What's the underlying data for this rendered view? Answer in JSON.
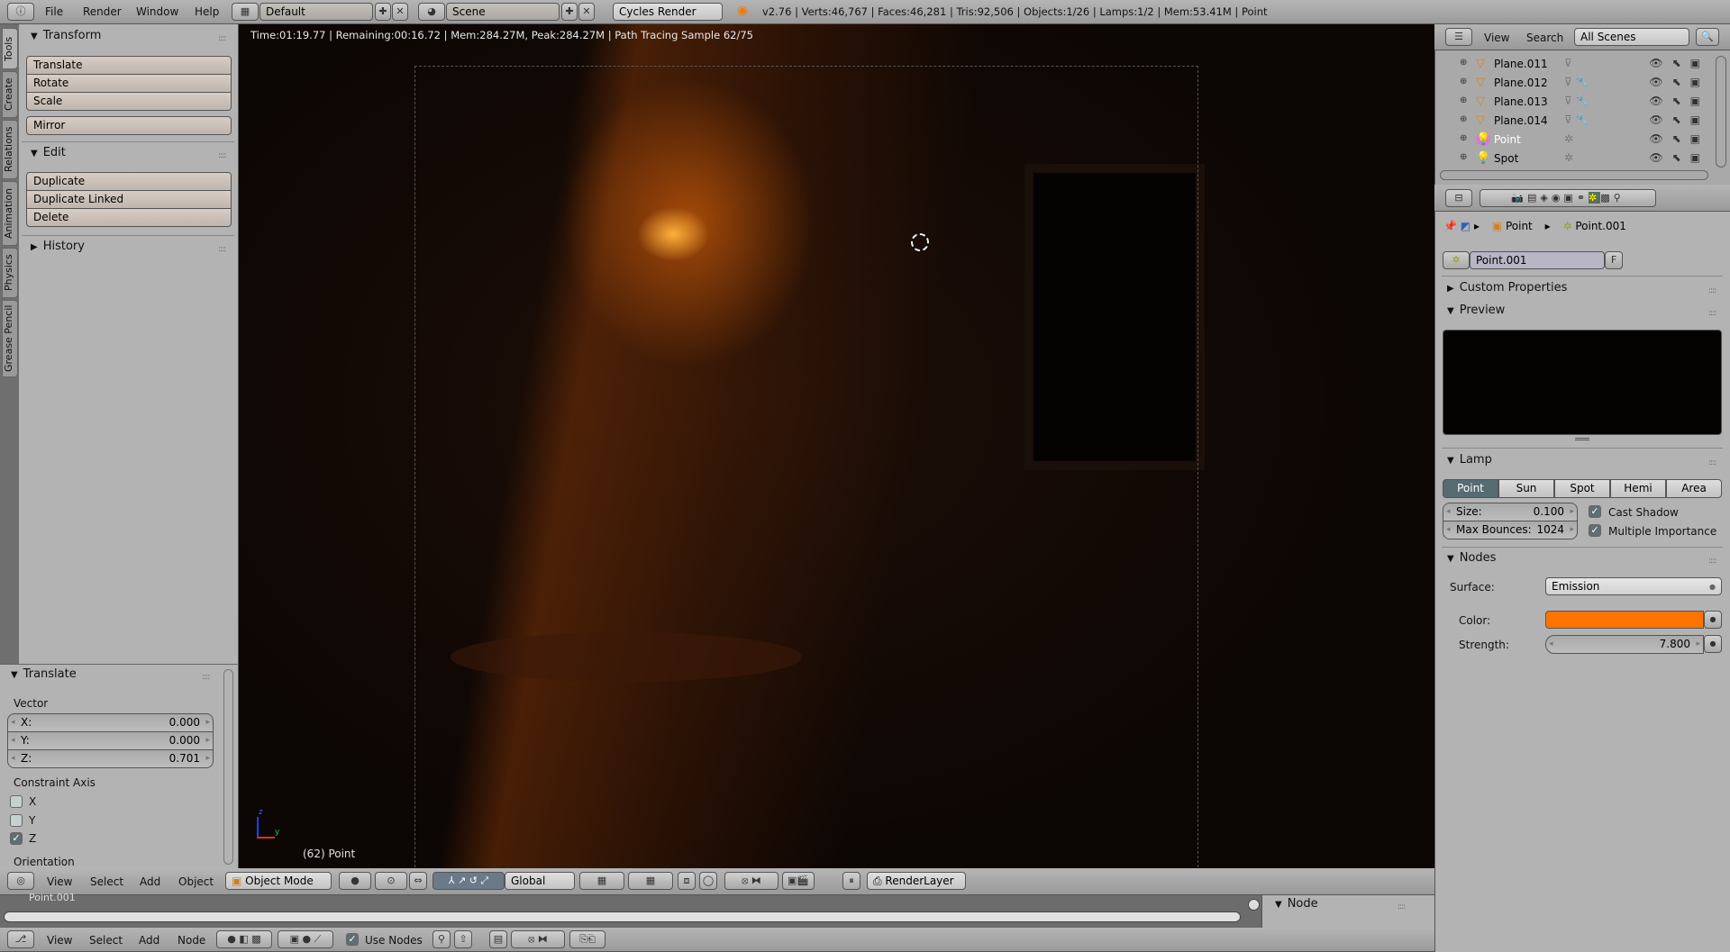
{
  "topbar": {
    "menus": [
      "File",
      "Render",
      "Window",
      "Help"
    ],
    "layout": "Default",
    "scene": "Scene",
    "engine": "Cycles Render",
    "stats": "v2.76 | Verts:46,767 | Faces:46,281 | Tris:92,506 | Objects:1/26 | Lamps:1/2 | Mem:53.41M | Point"
  },
  "tool_tabs": [
    "Tools",
    "Create",
    "Relations",
    "Animation",
    "Physics",
    "Grease Pencil"
  ],
  "toolshelf": {
    "transform": {
      "title": "Transform",
      "buttons": [
        "Translate",
        "Rotate",
        "Scale"
      ],
      "mirror": "Mirror"
    },
    "edit": {
      "title": "Edit",
      "buttons": [
        "Duplicate",
        "Duplicate Linked",
        "Delete"
      ]
    },
    "history": {
      "title": "History"
    }
  },
  "operator": {
    "title": "Translate",
    "vector_label": "Vector",
    "vector": [
      {
        "axis": "X:",
        "value": "0.000"
      },
      {
        "axis": "Y:",
        "value": "0.000"
      },
      {
        "axis": "Z:",
        "value": "0.701"
      }
    ],
    "constraint_label": "Constraint Axis",
    "constraints": [
      {
        "label": "X",
        "checked": false
      },
      {
        "label": "Y",
        "checked": false
      },
      {
        "label": "Z",
        "checked": true
      }
    ],
    "orientation_label": "Orientation"
  },
  "viewport": {
    "render_info": "Time:01:19.77 | Remaining:00:16.72 | Mem:284.27M, Peak:284.27M | Path Tracing Sample 62/75",
    "object_info": "(62) Point",
    "axis_z": "z",
    "axis_x": "x",
    "axis_y": "y"
  },
  "view3d_header": {
    "menus": [
      "View",
      "Select",
      "Add",
      "Object"
    ],
    "mode": "Object Mode",
    "orientation": "Global",
    "render_layer": "RenderLayer"
  },
  "node_editor": {
    "label": "Point.001",
    "side_title": "Node"
  },
  "node_header": {
    "menus": [
      "View",
      "Select",
      "Add",
      "Node"
    ],
    "use_nodes": "Use Nodes"
  },
  "outliner": {
    "menus": [
      "View",
      "Search"
    ],
    "filter": "All Scenes",
    "rows": [
      {
        "name": "Plane.011",
        "type": "mesh",
        "modifier": false
      },
      {
        "name": "Plane.012",
        "type": "mesh",
        "modifier": true
      },
      {
        "name": "Plane.013",
        "type": "mesh",
        "modifier": true
      },
      {
        "name": "Plane.014",
        "type": "mesh",
        "modifier": true
      },
      {
        "name": "Point",
        "type": "lamp",
        "selected": true
      },
      {
        "name": "Spot",
        "type": "lamp"
      }
    ]
  },
  "properties": {
    "breadcrumb": [
      "Point",
      "Point.001"
    ],
    "datablock": "Point.001",
    "fake_user": "F",
    "custom_props": "Custom Properties",
    "preview": "Preview",
    "lamp": {
      "title": "Lamp",
      "types": [
        "Point",
        "Sun",
        "Spot",
        "Hemi",
        "Area"
      ],
      "active": "Point",
      "size_label": "Size:",
      "size": "0.100",
      "bounces_label": "Max Bounces:",
      "bounces": "1024",
      "cast_shadow": "Cast Shadow",
      "multiple_importance": "Multiple Importance"
    },
    "nodes": {
      "title": "Nodes",
      "surface_label": "Surface:",
      "surface": "Emission",
      "color_label": "Color:",
      "color": "#ff7300",
      "strength_label": "Strength:",
      "strength": "7.800"
    }
  }
}
